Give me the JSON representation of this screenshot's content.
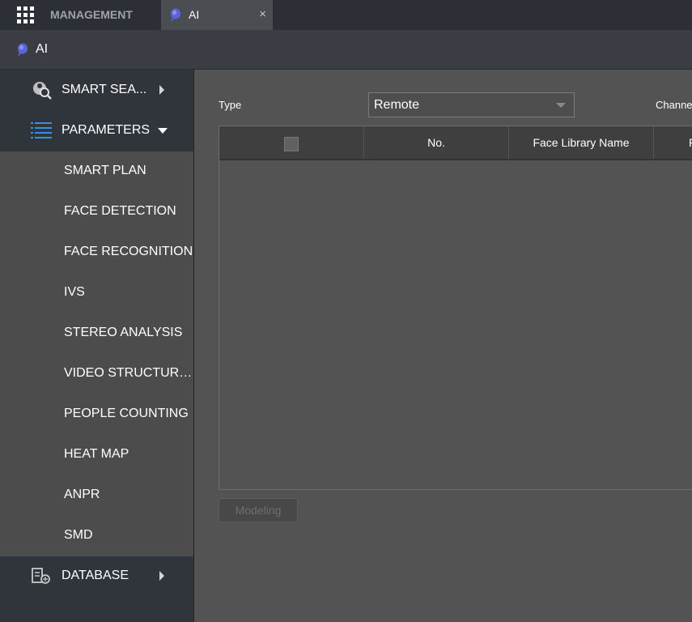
{
  "tabs": {
    "management_label": "MANAGEMENT",
    "active_label": "AI",
    "close_glyph": "×"
  },
  "page_title": "AI",
  "sidebar": {
    "smart_search": {
      "label": "SMART SEA...",
      "icon": "smart-search-icon"
    },
    "parameters": {
      "label": "PARAMETERS",
      "icon": "list-icon",
      "expanded": true,
      "items": [
        {
          "label": "SMART PLAN"
        },
        {
          "label": "FACE DETECTION"
        },
        {
          "label": "FACE RECOGNITION"
        },
        {
          "label": "IVS"
        },
        {
          "label": "STEREO ANALYSIS"
        },
        {
          "label": "VIDEO STRUCTURING"
        },
        {
          "label": "PEOPLE COUNTING"
        },
        {
          "label": "HEAT MAP"
        },
        {
          "label": "ANPR"
        },
        {
          "label": "SMD"
        }
      ]
    },
    "database": {
      "label": "DATABASE",
      "icon": "database-icon"
    }
  },
  "main": {
    "type_label": "Type",
    "type_value": "Remote",
    "channel_label": "Channel",
    "table": {
      "columns": [
        "",
        "No.",
        "Face Library Name",
        "P"
      ],
      "rows": []
    },
    "modeling_label": "Modeling"
  },
  "colors": {
    "accent_blue": "#3a8ee6",
    "sidebar_bg": "#30353b",
    "submenu_bg": "#4c4c4c",
    "content_bg": "#535353"
  }
}
